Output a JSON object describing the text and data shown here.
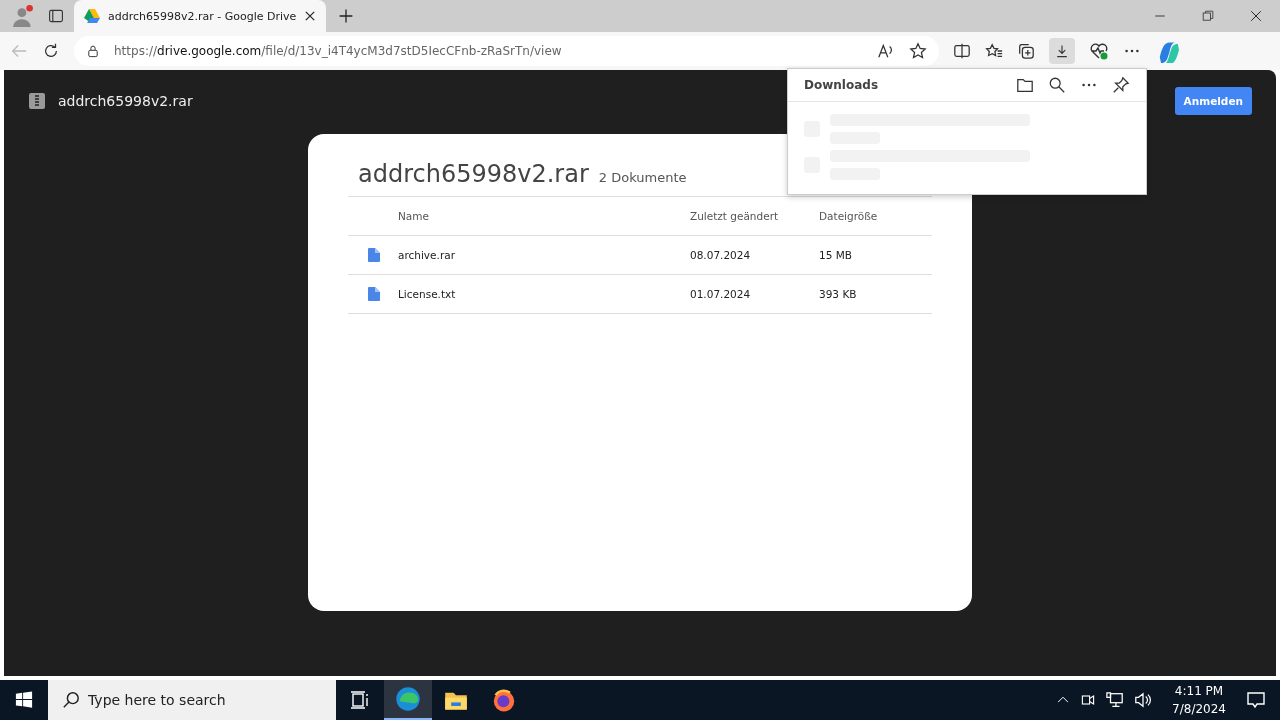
{
  "browser": {
    "tabs": [
      {
        "title": "addrch65998v2.rar - Google Drive",
        "selected": true
      }
    ],
    "url": {
      "scheme": "https://",
      "host": "drive.google.com",
      "path": "/file/d/13v_i4T4ycM3d7stD5IecCFnb-zRaSrTn/view"
    }
  },
  "drive": {
    "file_title": "addrch65998v2.rar",
    "sign_in": "Anmelden"
  },
  "archive": {
    "title": "addrch65998v2.rar",
    "count": "2 Dokumente",
    "columns": [
      "Name",
      "Zuletzt geändert",
      "Dateigröße"
    ],
    "rows": [
      {
        "name": "archive.rar",
        "modified": "08.07.2024",
        "size": "15 MB"
      },
      {
        "name": "License.txt",
        "modified": "01.07.2024",
        "size": "393 KB"
      }
    ]
  },
  "downloads": {
    "title": "Downloads"
  },
  "taskbar": {
    "search_placeholder": "Type here to search",
    "time": "4:11 PM",
    "date": "7/8/2024"
  }
}
